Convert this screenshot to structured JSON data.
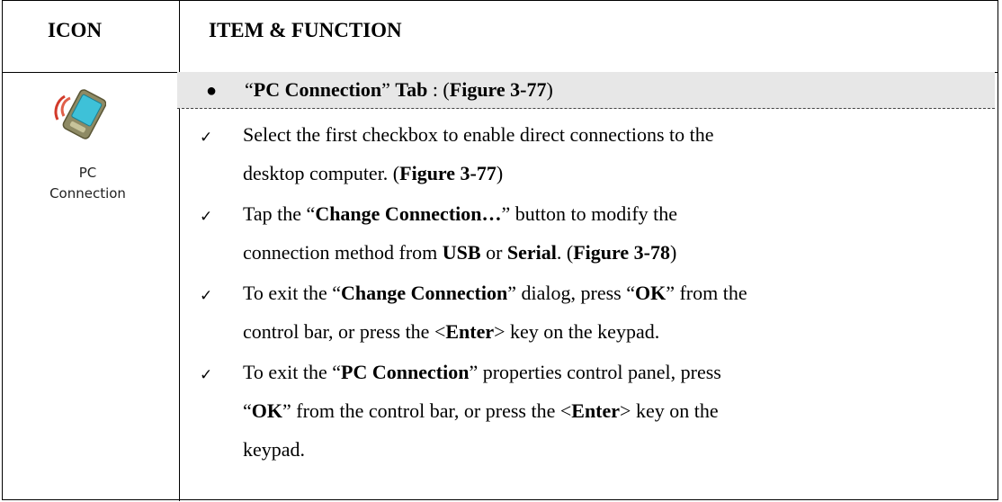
{
  "header": {
    "icon_col": "ICON",
    "item_col": "ITEM & FUNCTION"
  },
  "icon": {
    "name": "pc-connection-icon",
    "label_line1": "PC",
    "label_line2": "Connection"
  },
  "tab_row": {
    "q1": "“",
    "tab_name": "PC Connection",
    "q2": "”",
    "tab_word": "Tab",
    "sep": " : (",
    "figure": "Figure 3-77",
    "close": ")"
  },
  "items": {
    "i1": {
      "l1": "Select the first checkbox to enable direct connections to the",
      "l2_pre": "desktop computer. (",
      "l2_fig": "Figure 3-77",
      "l2_post": ")"
    },
    "i2": {
      "l1_pre": "Tap the “",
      "l1_bold": "Change Connection…",
      "l1_post": "” button to modify the",
      "l2_pre": "connection method from ",
      "l2_usb": "USB",
      "l2_or": " or ",
      "l2_serial": "Serial",
      "l2_mid": ". (",
      "l2_fig": "Figure 3-78",
      "l2_post": ")"
    },
    "i3": {
      "l1_pre": "To exit the “",
      "l1_bold": "Change Connection",
      "l1_mid": "” dialog, press “",
      "l1_ok": "OK",
      "l1_post": "” from the",
      "l2_pre": "control bar, or press the <",
      "l2_enter": "Enter",
      "l2_post": "> key on the keypad."
    },
    "i4": {
      "l1_pre": "To exit the “",
      "l1_bold": "PC Connection",
      "l1_post": "” properties control panel, press",
      "l2_q": "“",
      "l2_ok": "OK",
      "l2_mid": "” from the control bar, or press the <",
      "l2_enter": "Enter",
      "l2_post": "> key on the",
      "l3": "keypad."
    }
  },
  "checkmark": "✓",
  "bullet": "●"
}
